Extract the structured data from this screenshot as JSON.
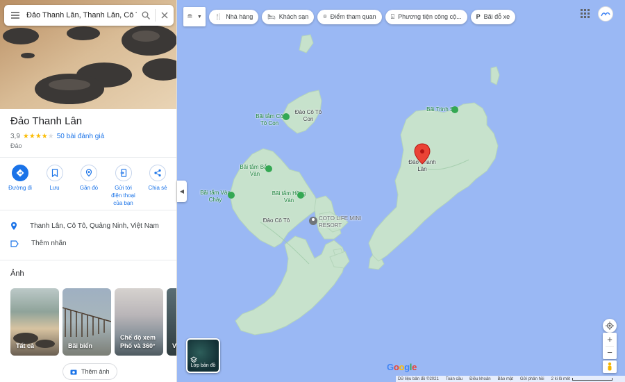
{
  "search": {
    "query": "Đảo Thanh Lân, Thanh Lân, Cô Tô"
  },
  "place": {
    "title": "Đảo Thanh Lân",
    "rating": "3,9",
    "stars": 4,
    "reviews": "50 bài đánh giá",
    "type": "Đảo"
  },
  "actions": [
    {
      "label": "Đường đi",
      "icon": "directions-icon"
    },
    {
      "label": "Lưu",
      "icon": "bookmark-icon"
    },
    {
      "label": "Gần đó",
      "icon": "nearby-icon"
    },
    {
      "label": "Gửi tới điện thoại của bạn",
      "icon": "send-to-phone-icon"
    },
    {
      "label": "Chia sẻ",
      "icon": "share-icon"
    }
  ],
  "info": {
    "address": "Thanh Lân, Cô Tô, Quảng Ninh, Việt Nam",
    "add_label": "Thêm nhãn"
  },
  "photos": {
    "title": "Ảnh",
    "items": [
      {
        "caption": "Tất cả"
      },
      {
        "caption": "Bãi biển"
      },
      {
        "caption": "Chế độ xem Phố và 360°"
      },
      {
        "caption": "Vi"
      }
    ],
    "add_button": "Thêm ảnh"
  },
  "chips": [
    {
      "label": "Nhà hàng",
      "icon": "restaurant-icon"
    },
    {
      "label": "Khách sạn",
      "icon": "hotel-icon"
    },
    {
      "label": "Điểm tham quan",
      "icon": "attraction-icon"
    },
    {
      "label": "Phương tiện công cộ...",
      "icon": "transit-icon"
    },
    {
      "label": "Bãi đỗ xe",
      "icon": "parking-icon"
    }
  ],
  "map": {
    "labels": {
      "co_to_con_beach": "Bãi tắm Cô Tô Con",
      "co_to_con_island": "Đảo Cô Tô Con",
      "bac_van": "Bãi tắm Bắc Vàn",
      "van_chay": "Bãi tắm Vàn Chảy",
      "hong_van": "Bãi tắm Hồng Vàn",
      "co_to_island": "Đảo Cô Tô",
      "resort": "COTO LIFE MINI RESORT",
      "trinh_sat": "Bãi Trinh Sát",
      "thanh_lan": "Đảo Thanh Lân"
    },
    "layer_toggle": "Lớp bản đồ",
    "logo": "Google",
    "footer": {
      "map_data": "Dữ liệu bản đồ ©2021",
      "global": "Toàn cầu",
      "terms": "Điều khoản",
      "privacy": "Bảo mật",
      "feedback": "Gửi phản hồi",
      "scale": "2 ki lô mét"
    }
  },
  "colors": {
    "water": "#9ab8f4",
    "land": "#c7e2cc",
    "accent": "#1a73e8",
    "pin": "#ea4335"
  }
}
